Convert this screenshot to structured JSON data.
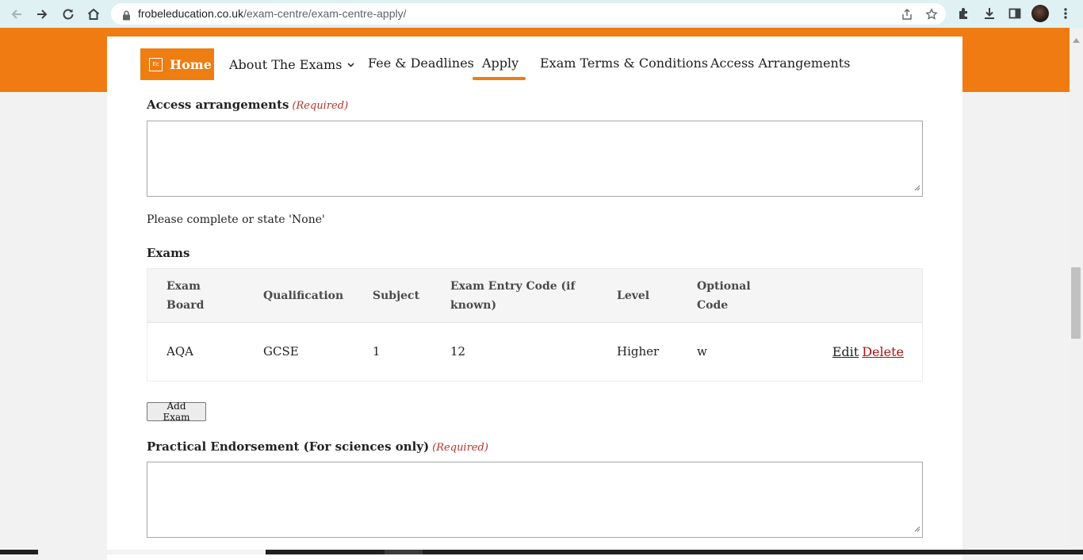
{
  "browser": {
    "url_host": "frobeleducation.co.uk",
    "url_path": "/exam-centre/exam-centre-apply/"
  },
  "nav": {
    "home_logo": "Ec",
    "home_label": "Home",
    "items": [
      {
        "label": "About The Exams"
      },
      {
        "label": "Fee & Deadlines"
      },
      {
        "label": "Apply"
      },
      {
        "label": "Exam Terms & Conditions"
      },
      {
        "label": "Access Arrangements"
      }
    ],
    "active": "Apply",
    "accent_color": "#f07b12"
  },
  "form": {
    "access": {
      "label": "Access arrangements",
      "required": "(Required)",
      "value": "",
      "help": "Please complete or state 'None'"
    },
    "exams": {
      "title": "Exams",
      "headers": [
        "Exam Board",
        "Qualification",
        "Subject",
        "Exam Entry Code (if known)",
        "Level",
        "Optional Code"
      ],
      "rows": [
        {
          "board": "AQA",
          "qualification": "GCSE",
          "subject": "1",
          "entry_code": "12",
          "level": "Higher",
          "optional_code": "w",
          "edit": "Edit",
          "delete": "Delete"
        }
      ],
      "add_button": "Add Exam"
    },
    "practical": {
      "label": "Practical Endorsement (For sciences only)",
      "required": "(Required)",
      "value": ""
    }
  }
}
